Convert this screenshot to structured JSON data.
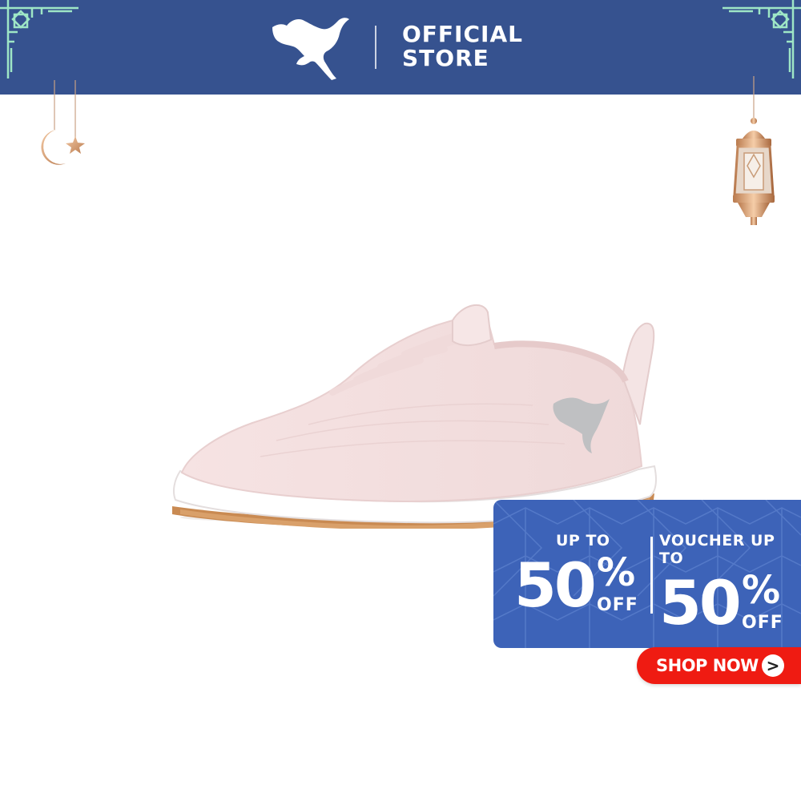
{
  "header": {
    "brand_icon": "puma-cat-logo",
    "store_line1": "OFFICIAL",
    "store_line2": "STORE",
    "background_color": "#36528f"
  },
  "decorations": {
    "left": "crescent-moon-and-star-icon",
    "right": "ramadan-lantern-icon"
  },
  "product": {
    "icon": "pink-sneaker-image"
  },
  "promo": {
    "left": {
      "top": "UP TO",
      "number": "50",
      "percent": "%",
      "suffix": "OFF"
    },
    "right": {
      "top": "VOUCHER UP TO",
      "number": "50",
      "percent": "%",
      "suffix": "OFF"
    },
    "background_color": "#3d63b8"
  },
  "cta": {
    "label": "SHOP NOW",
    "arrow": ">",
    "color": "#ef1b12"
  }
}
